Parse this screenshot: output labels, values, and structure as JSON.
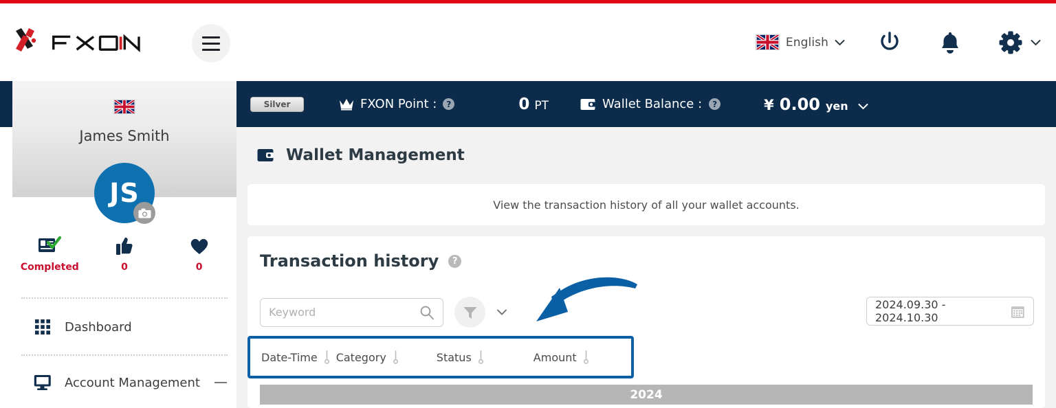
{
  "brand": {
    "name": "FXON",
    "logo_icon": "fxon-logo",
    "menu_icon": "hamburger-menu-icon"
  },
  "header": {
    "language": {
      "label": "English",
      "flag_icon": "uk-flag-icon",
      "chevron_icon": "chevron-down-icon"
    },
    "power_icon": "power-icon",
    "notification_icon": "bell-icon",
    "settings_icon": "gear-icon",
    "settings_chevron_icon": "chevron-down-icon"
  },
  "status_strip": {
    "tier_badge": "Silver",
    "point_icon": "crown-icon",
    "point_label": "FXON Point :",
    "point_help_icon": "question-mark-icon",
    "point_value": "0",
    "point_unit": "PT",
    "wallet_icon": "wallet-icon",
    "wallet_label": "Wallet Balance :",
    "wallet_help_icon": "question-mark-icon",
    "currency_symbol": "¥",
    "wallet_value": "0.00",
    "currency_unit": "yen",
    "currency_chevron_icon": "chevron-down-icon"
  },
  "sidebar": {
    "flag_icon": "uk-flag-icon",
    "user_name": "James Smith",
    "avatar_initials": "JS",
    "camera_icon": "camera-icon",
    "stats": [
      {
        "icon": "id-card-verified-icon",
        "label": "Completed"
      },
      {
        "icon": "thumbs-up-icon",
        "label": "0"
      },
      {
        "icon": "heart-icon",
        "label": "0"
      }
    ],
    "items": [
      {
        "icon": "grid-icon",
        "label": "Dashboard",
        "has_collapse": false
      },
      {
        "icon": "monitor-icon",
        "label": "Account Management",
        "has_collapse": true
      }
    ]
  },
  "main": {
    "page_icon": "wallet-icon",
    "page_title": "Wallet Management",
    "description": "View the transaction history of all your wallet accounts.",
    "transaction": {
      "title": "Transaction history",
      "help_icon": "question-mark-icon",
      "search_placeholder": "Keyword",
      "search_value": "",
      "search_icon": "search-icon",
      "filter_icon": "funnel-icon",
      "filter_chevron_icon": "chevron-down-icon",
      "date_range": "2024.09.30 - 2024.10.30",
      "calendar_icon": "calendar-icon",
      "columns": [
        {
          "label": "Date-Time",
          "sort_icon": "sort-handle-icon"
        },
        {
          "label": "Category",
          "sort_icon": "sort-handle-icon"
        },
        {
          "label": "Status",
          "sort_icon": "sort-handle-icon"
        },
        {
          "label": "Amount",
          "sort_icon": "sort-handle-icon"
        }
      ],
      "year_group": "2024"
    }
  },
  "annotation": {
    "arrow_icon": "curved-arrow-icon",
    "highlight_color": "#0a5fa5"
  },
  "colors": {
    "brand_red": "#e30613",
    "navy": "#0d2c4b",
    "avatar_blue": "#1071b0",
    "accent_blue": "#0a5fa5",
    "stat_red": "#c8102e",
    "year_gray": "#b6b6b6"
  }
}
